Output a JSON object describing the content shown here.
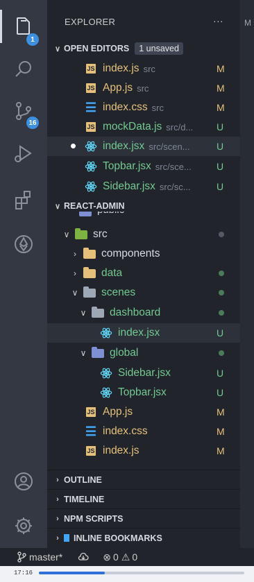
{
  "activity_bar": {
    "explorer_badge": "1",
    "scm_badge": "16"
  },
  "explorer": {
    "title": "EXPLORER",
    "more_actions": "···",
    "editor_tab_partial": "M"
  },
  "open_editors": {
    "label": "OPEN EDITORS",
    "unsaved_badge": "1 unsaved",
    "items": [
      {
        "name": "index.js",
        "path": "src",
        "status": "M",
        "icon": "js-file-icon"
      },
      {
        "name": "App.js",
        "path": "src",
        "status": "M",
        "icon": "js-file-icon"
      },
      {
        "name": "index.css",
        "path": "src",
        "status": "M",
        "icon": "css-file-icon"
      },
      {
        "name": "mockData.js",
        "path": "src/d...",
        "status": "U",
        "icon": "js-file-icon"
      },
      {
        "name": "index.jsx",
        "path": "src/scen...",
        "status": "U",
        "icon": "react-file-icon",
        "unsaved": true
      },
      {
        "name": "Topbar.jsx",
        "path": "src/sce...",
        "status": "U",
        "icon": "react-file-icon"
      },
      {
        "name": "Sidebar.jsx",
        "path": "src/sc...",
        "status": "U",
        "icon": "react-file-icon"
      }
    ]
  },
  "project": {
    "label": "REACT-ADMIN",
    "partial_top": "public",
    "tree": [
      {
        "name": "src",
        "type": "folder",
        "open": true,
        "status": "dotgrey",
        "icon": "folder-src-icon"
      },
      {
        "name": "components",
        "type": "folder",
        "open": false,
        "status": "",
        "icon": "folder-components-icon"
      },
      {
        "name": "data",
        "type": "folder",
        "open": false,
        "status": "dot",
        "icon": "folder-data-icon"
      },
      {
        "name": "scenes",
        "type": "folder",
        "open": true,
        "status": "dot",
        "icon": "folder-scenes-icon"
      },
      {
        "name": "dashboard",
        "type": "folder",
        "open": true,
        "status": "dot",
        "icon": "folder-dashboard-icon"
      },
      {
        "name": "index.jsx",
        "type": "file",
        "status": "U",
        "icon": "react-file-icon"
      },
      {
        "name": "global",
        "type": "folder",
        "open": true,
        "status": "dot",
        "icon": "folder-global-icon"
      },
      {
        "name": "Sidebar.jsx",
        "type": "file",
        "status": "U",
        "icon": "react-file-icon"
      },
      {
        "name": "Topbar.jsx",
        "type": "file",
        "status": "U",
        "icon": "react-file-icon"
      },
      {
        "name": "App.js",
        "type": "file",
        "status": "M",
        "icon": "js-file-icon"
      },
      {
        "name": "index.css",
        "type": "file",
        "status": "M",
        "icon": "css-file-icon"
      },
      {
        "name": "index.js",
        "type": "file",
        "status": "M",
        "icon": "js-file-icon"
      }
    ]
  },
  "collapsed_sections": {
    "outline": "OUTLINE",
    "timeline": "TIMELINE",
    "npm_scripts": "NPM SCRIPTS",
    "inline_bookmarks": "INLINE BOOKMARKS"
  },
  "status_bar": {
    "branch": "master*",
    "errors": "0",
    "warnings": "0"
  },
  "video": {
    "time": "17:16",
    "progress": 0.32
  },
  "colors": {
    "modified": "#e5c07b",
    "untracked": "#73c991",
    "accent": "#3d8fe0"
  }
}
